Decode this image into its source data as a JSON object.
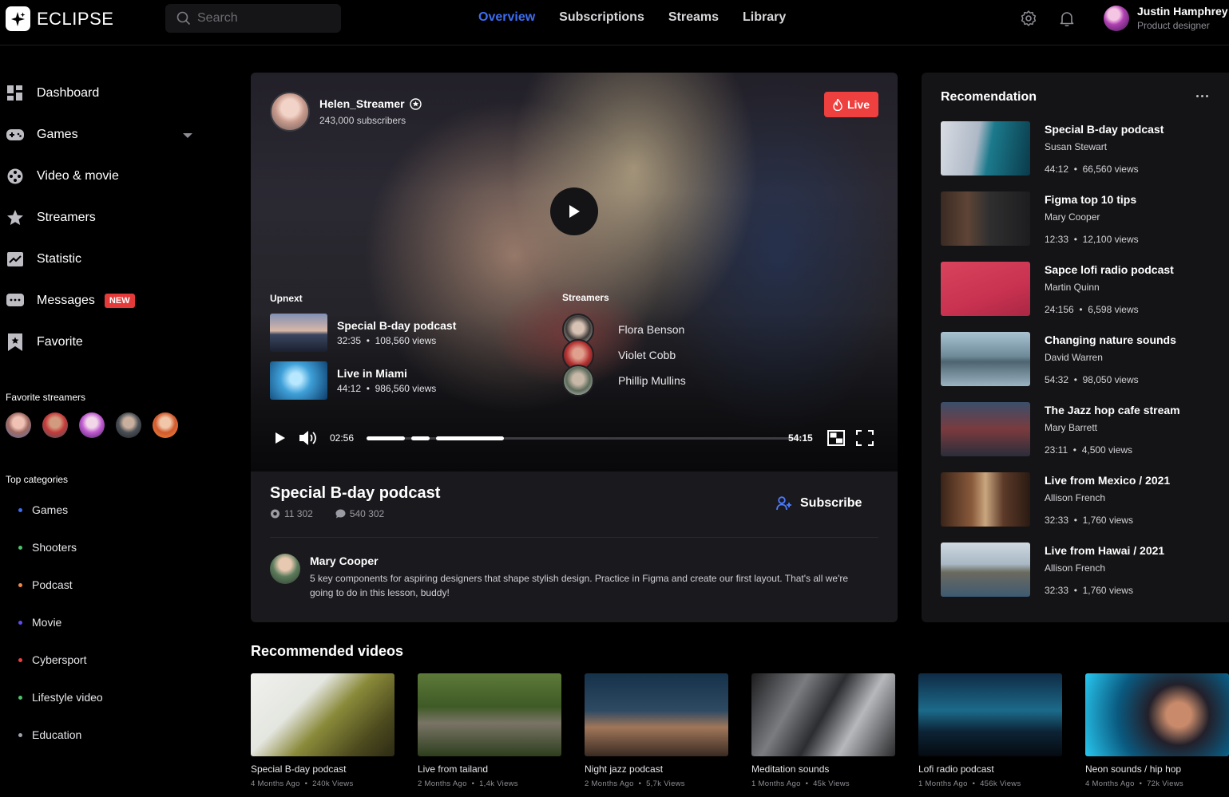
{
  "app": {
    "name": "ECLIPSE"
  },
  "search": {
    "placeholder": "Search"
  },
  "nav": {
    "items": [
      "Overview",
      "Subscriptions",
      "Streams",
      "Library"
    ],
    "active": "Overview"
  },
  "user": {
    "name": "Justin Hamphrey",
    "role": "Product designer"
  },
  "sidebar": {
    "items": [
      {
        "label": "Dashboard",
        "icon": "dashboard-icon"
      },
      {
        "label": "Games",
        "icon": "gamepad-icon"
      },
      {
        "label": "Video & movie",
        "icon": "film-reel-icon"
      },
      {
        "label": "Streamers",
        "icon": "star-icon"
      },
      {
        "label": "Statistic",
        "icon": "chart-icon"
      },
      {
        "label": "Messages",
        "icon": "message-icon",
        "badge": "NEW"
      },
      {
        "label": "Favorite",
        "icon": "bookmark-icon"
      }
    ],
    "favorite_title": "Favorite streamers",
    "categories_title": "Top categories",
    "categories": [
      {
        "label": "Games",
        "color": "#3d6df2"
      },
      {
        "label": "Shooters",
        "color": "#4cc46b"
      },
      {
        "label": "Podcast",
        "color": "#f0894a"
      },
      {
        "label": "Movie",
        "color": "#5c4df0"
      },
      {
        "label": "Cybersport",
        "color": "#ef4040"
      },
      {
        "label": "Lifestyle video",
        "color": "#4cc46b"
      },
      {
        "label": "Education",
        "color": "#9fa3b0"
      }
    ]
  },
  "player": {
    "streamer": {
      "name": "Helen_Streamer",
      "subscribers": "243,000 subscribers"
    },
    "live_label": "Live",
    "upnext_title": "Upnext",
    "upnext": [
      {
        "title": "Special B-day podcast",
        "duration": "32:35",
        "views": "108,560 views"
      },
      {
        "title": "Live in Miami",
        "duration": "44:12",
        "views": "986,560 views"
      }
    ],
    "streamers_title": "Streamers",
    "streamers": [
      "Flora Benson",
      "Violet Cobb",
      "Phillip Mullins"
    ],
    "current_time": "02:56",
    "total_time": "54:15",
    "progress": 0.34
  },
  "video": {
    "title": "Special B-day podcast",
    "views": "11 302",
    "comments": "540 302",
    "subscribe_label": "Subscribe",
    "comment": {
      "author": "Mary Cooper",
      "text": "5 key components for aspiring designers that shape stylish design. Practice in Figma and create our first layout. That's all we're going to do in this lesson, buddy!"
    }
  },
  "recommendation": {
    "title": "Recomendation",
    "items": [
      {
        "title": "Special B-day podcast",
        "author": "Susan Stewart",
        "duration": "44:12",
        "views": "66,560 views"
      },
      {
        "title": "Figma top 10 tips",
        "author": "Mary Cooper",
        "duration": "12:33",
        "views": "12,100 views"
      },
      {
        "title": "Sapce lofi radio podcast",
        "author": "Martin Quinn",
        "duration": "24:156",
        "views": "6,598 views"
      },
      {
        "title": "Changing nature sounds",
        "author": "David Warren",
        "duration": "54:32",
        "views": "98,050 views"
      },
      {
        "title": "The Jazz hop cafe stream",
        "author": "Mary Barrett",
        "duration": "23:11",
        "views": "4,500 views"
      },
      {
        "title": "Live from Mexico / 2021",
        "author": "Allison French",
        "duration": "32:33",
        "views": "1,760 views"
      },
      {
        "title": "Live from Hawai / 2021",
        "author": "Allison French",
        "duration": "32:33",
        "views": "1,760 views"
      }
    ]
  },
  "recommended_videos": {
    "title": "Recommended videos",
    "items": [
      {
        "title": "Special B-day podcast",
        "age": "4 Months Ago",
        "views": "240k Views"
      },
      {
        "title": "Live from tailand",
        "age": "2 Months Ago",
        "views": "1,4k Views"
      },
      {
        "title": "Night jazz podcast",
        "age": "2 Months Ago",
        "views": "5,7k Views"
      },
      {
        "title": "Meditation sounds",
        "age": "1 Months Ago",
        "views": "45k Views"
      },
      {
        "title": "Lofi radio podcast",
        "age": "1 Months Ago",
        "views": "456k Views"
      },
      {
        "title": "Neon sounds / hip hop",
        "age": "4 Months Ago",
        "views": "72k Views"
      }
    ]
  }
}
